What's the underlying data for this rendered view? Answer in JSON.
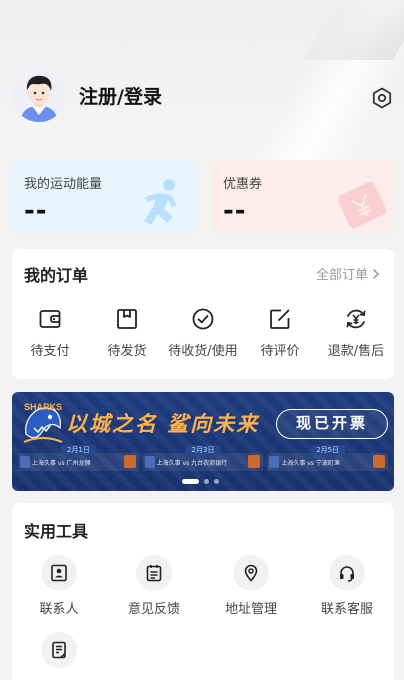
{
  "profile": {
    "login_label": "注册/登录",
    "icons": {
      "avatar": "avatar-cartoon",
      "settings": "gear-icon"
    }
  },
  "stats": {
    "energy": {
      "label": "我的运动能量",
      "value": "--",
      "icon": "runner-icon"
    },
    "coupon": {
      "label": "优惠券",
      "value": "--",
      "icon": "ticket-icon"
    }
  },
  "orders": {
    "title": "我的订单",
    "all_label": "全部订单",
    "items": [
      {
        "label": "待支付",
        "icon": "wallet-icon"
      },
      {
        "label": "待发货",
        "icon": "box-icon"
      },
      {
        "label": "待收货/使用",
        "icon": "check-circle-icon"
      },
      {
        "label": "待评价",
        "icon": "edit-icon"
      },
      {
        "label": "退款/售后",
        "icon": "refund-icon"
      }
    ]
  },
  "banner": {
    "slogan": "以城之名 鲨向未来",
    "cta": "现已开票",
    "logo_text": "SHARKS",
    "games": [
      {
        "date": "2月1日",
        "text": "上海久事 vs 广州龙狮"
      },
      {
        "date": "2月3日",
        "text": "上海久事 vs 九台农商银行"
      },
      {
        "date": "2月5日",
        "text": "上海久事 vs 宁波町渔"
      }
    ],
    "pages": 3,
    "active_page": 1
  },
  "tools": {
    "title": "实用工具",
    "items": [
      {
        "label": "联系人",
        "icon": "contact-icon"
      },
      {
        "label": "意见反馈",
        "icon": "feedback-icon"
      },
      {
        "label": "地址管理",
        "icon": "location-icon"
      },
      {
        "label": "联系客服",
        "icon": "headset-icon"
      },
      {
        "label": "",
        "icon": "document-icon"
      }
    ]
  },
  "colors": {
    "energy_card": "#e8f4fe",
    "coupon_card": "#fdecec",
    "banner_bg": "#1f3d7e",
    "banner_accent": "#ffb24a"
  }
}
